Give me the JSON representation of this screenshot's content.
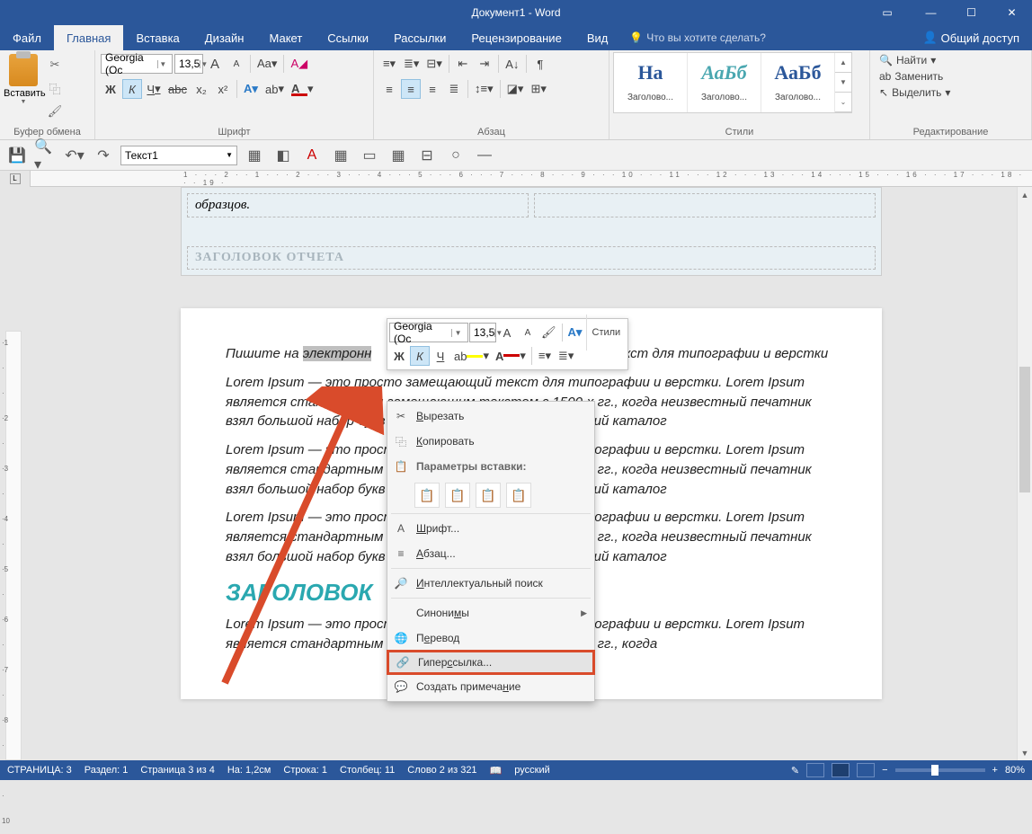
{
  "app": {
    "title": "Документ1 - Word"
  },
  "tabs": {
    "file": "Файл",
    "home": "Главная",
    "insert": "Вставка",
    "design": "Дизайн",
    "layout": "Макет",
    "refs": "Ссылки",
    "mailings": "Рассылки",
    "review": "Рецензирование",
    "view": "Вид",
    "tellme": "Что вы хотите сделать?",
    "share": "Общий доступ"
  },
  "ribbon": {
    "clipboard": {
      "paste": "Вставить",
      "group": "Буфер обмена"
    },
    "font": {
      "name": "Georgia (Ос",
      "size": "13,5",
      "group": "Шрифт",
      "bold": "Ж",
      "italic": "К",
      "underline": "Ч",
      "strike": "abc",
      "sub": "x₂",
      "sup": "x²"
    },
    "para": {
      "group": "Абзац"
    },
    "styles": {
      "group": "Стили",
      "items": [
        {
          "preview": "На",
          "color": "#2b579a",
          "name": "Заголово..."
        },
        {
          "preview": "АаБб",
          "color": "#4aa7b0",
          "italic": true,
          "name": "Заголово..."
        },
        {
          "preview": "АаБб",
          "color": "#2b579a",
          "name": "Заголово..."
        }
      ]
    },
    "editing": {
      "find": "Найти",
      "replace": "Заменить",
      "select": "Выделить",
      "group": "Редактирование"
    }
  },
  "qat2": {
    "style_combo": "Текст1"
  },
  "ruler": "1 · · · 2 · · 1 · · · 2 · · · 3 · · · 4 · · · 5 · · · 6 · · · 7 · · · 8 · · · 9 · · · 10 · · · 11 · · · 12 · · · 13 · · · 14 · · · 15 · · · 16 · · · 17 · · · 18 · · · 19 ·",
  "doc": {
    "top_cell": "образцов.",
    "header_placeholder": "ЗАГОЛОВОК ОТЧЕТА",
    "p1a": "Пишите на ",
    "p1_sel": "электронн",
    "p1b": "мещающий текст для типографии и верстки",
    "lorem1": "Lorem Ipsum — это просто замещающий текст для типографии и верстки. Lorem Ipsum является стандартным замещающим текстом с 1500-х гг., когда неизвестный печатник взял большой набор букв и скомпоновал их в типографский каталог",
    "heading": "ЗАГОЛОВОК",
    "lorem_last": "Lorem Ipsum — это просто замещающий текст для типографии и верстки. Lorem Ipsum является стандартным замещающим текстом с 1500-х гг., когда"
  },
  "mini": {
    "font": "Georgia (Ос",
    "size": "13,5",
    "bold": "Ж",
    "italic": "К",
    "underline": "Ч",
    "styles": "Стили"
  },
  "ctx": {
    "cut": "Вырезать",
    "copy": "Копировать",
    "paste_header": "Параметры вставки:",
    "font": "Шрифт...",
    "para": "Абзац...",
    "smart": "Интеллектуальный поиск",
    "synonyms": "Синонимы",
    "translate": "Перевод",
    "hyperlink": "Гиперссылка...",
    "comment": "Создать примечание"
  },
  "status": {
    "page": "СТРАНИЦА: 3",
    "section": "Раздел: 1",
    "page_of": "Страница 3 из 4",
    "at": "На: 1,2см",
    "line": "Строка: 1",
    "col": "Столбец: 11",
    "words": "Слово 2 из 321",
    "lang": "русский",
    "zoom": "80%"
  }
}
